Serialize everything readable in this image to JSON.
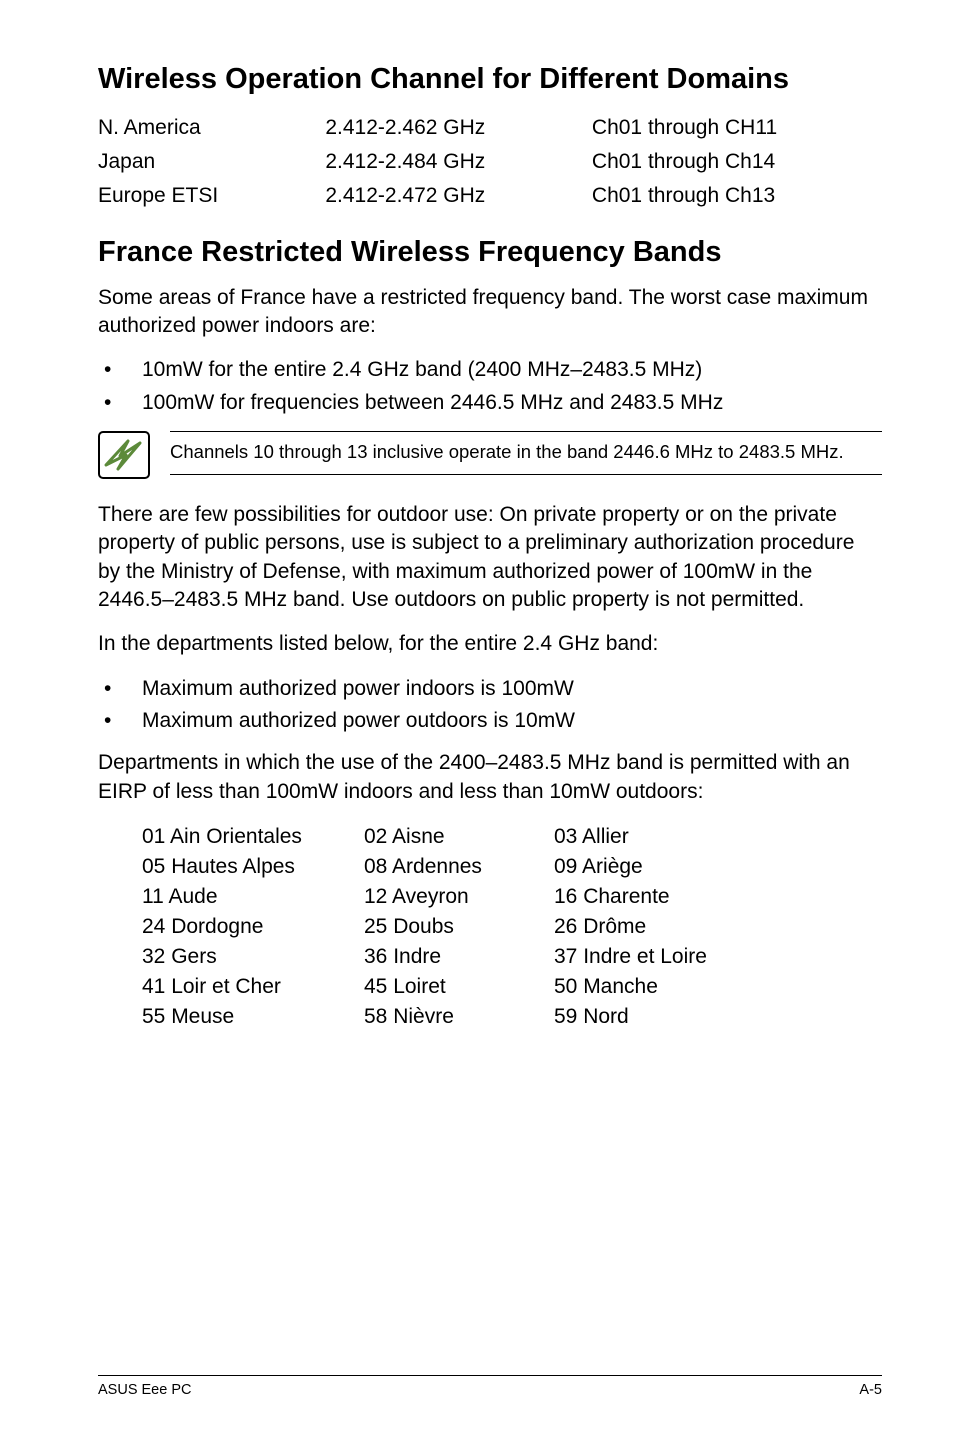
{
  "headings": {
    "wireless": "Wireless Operation Channel for Different Domains",
    "france": "France Restricted Wireless Frequency Bands"
  },
  "channel_table": [
    {
      "region": "N. America",
      "freq": "2.412-2.462 GHz",
      "ch": "Ch01 through CH11"
    },
    {
      "region": "Japan",
      "freq": "2.412-2.484 GHz",
      "ch": "Ch01 through Ch14"
    },
    {
      "region": "Europe ETSI",
      "freq": "2.412-2.472 GHz",
      "ch": "Ch01 through Ch13"
    }
  ],
  "france_intro": "Some areas of France have a restricted frequency band. The worst case maximum authorized power indoors are:",
  "france_limits": [
    "10mW for the entire 2.4 GHz band (2400 MHz–2483.5 MHz)",
    "100mW for frequencies between 2446.5 MHz and 2483.5 MHz"
  ],
  "note": "Channels 10 through 13 inclusive operate in the band 2446.6 MHz to 2483.5 MHz.",
  "outdoor_para": "There are few possibilities for outdoor use: On private property or on the private property of public persons, use is subject to a preliminary authorization procedure by the Ministry of Defense, with maximum authorized power of 100mW in the 2446.5–2483.5 MHz band. Use outdoors on public property is not permitted.",
  "dept_intro": "In the departments listed below, for the entire 2.4 GHz band:",
  "dept_limits": [
    "Maximum authorized power indoors is 100mW",
    "Maximum authorized power outdoors is 10mW"
  ],
  "dept_band_para": "Departments in which the use of the 2400–2483.5 MHz band is permitted with an EIRP of less than 100mW indoors and less than 10mW outdoors:",
  "departments": [
    [
      "01  Ain Orientales",
      "02  Aisne",
      "03  Allier"
    ],
    [
      "05  Hautes Alpes",
      "08  Ardennes",
      "09  Ariège"
    ],
    [
      "11  Aude",
      "12  Aveyron",
      "16  Charente"
    ],
    [
      "24  Dordogne",
      "25  Doubs",
      "26  Drôme"
    ],
    [
      "32  Gers",
      "36  Indre",
      "37  Indre et Loire"
    ],
    [
      "41  Loir et Cher",
      "45  Loiret",
      "50  Manche"
    ],
    [
      "55  Meuse",
      "58  Nièvre",
      "59  Nord"
    ]
  ],
  "footer": {
    "left": "ASUS Eee PC",
    "right": "A-5"
  }
}
